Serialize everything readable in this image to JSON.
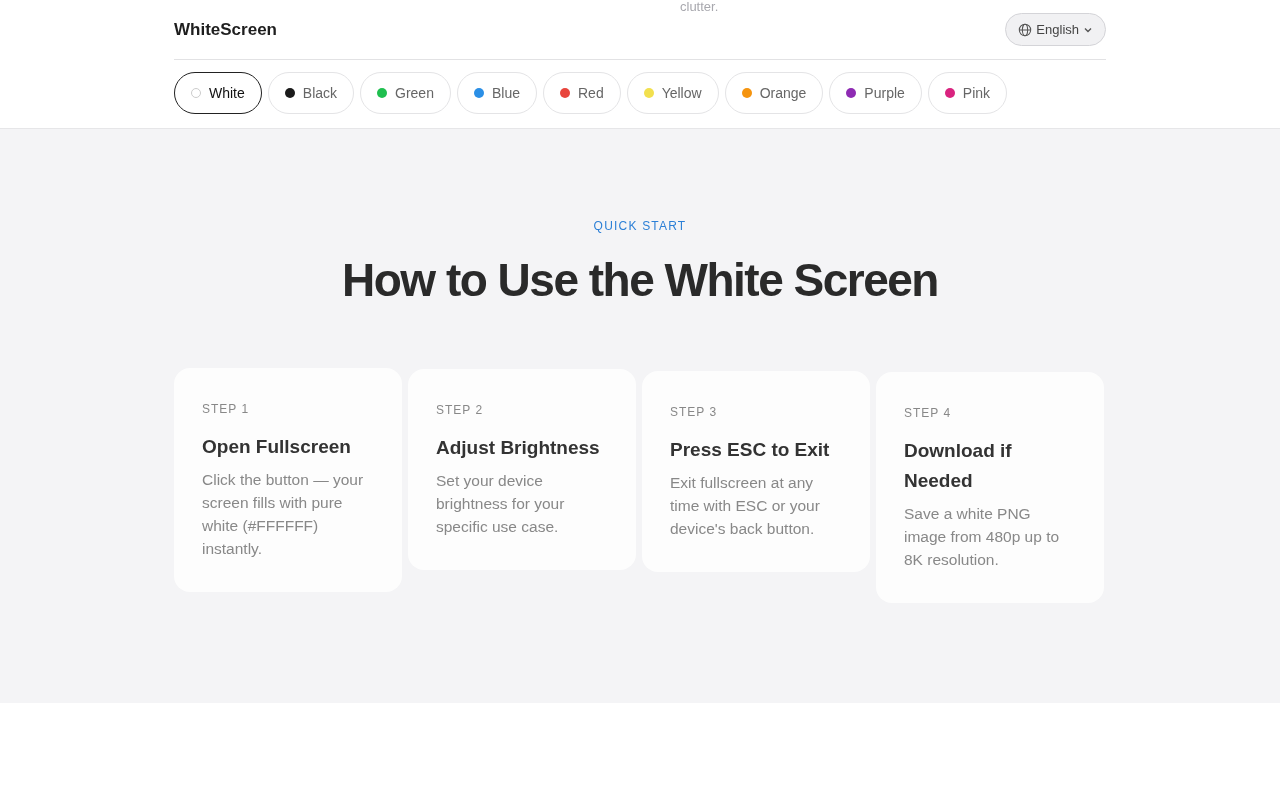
{
  "behind_text": "clutter.",
  "brand": "WhiteScreen",
  "language": {
    "label": "English"
  },
  "colors": [
    {
      "label": "White",
      "color": "#ffffff",
      "selected": true
    },
    {
      "label": "Black",
      "color": "#1a1a1a",
      "selected": false
    },
    {
      "label": "Green",
      "color": "#1fbf4f",
      "selected": false
    },
    {
      "label": "Blue",
      "color": "#2b8fe6",
      "selected": false
    },
    {
      "label": "Red",
      "color": "#e8453c",
      "selected": false
    },
    {
      "label": "Yellow",
      "color": "#f2e04e",
      "selected": false
    },
    {
      "label": "Orange",
      "color": "#f5940f",
      "selected": false
    },
    {
      "label": "Purple",
      "color": "#8e2bb3",
      "selected": false
    },
    {
      "label": "Pink",
      "color": "#d9237f",
      "selected": false
    }
  ],
  "section": {
    "eyebrow": "QUICK START",
    "title": "How to Use the White Screen",
    "steps": [
      {
        "step": "STEP 1",
        "title": "Open Fullscreen",
        "text": "Click the button — your screen fills with pure white (#FFFFFF) instantly."
      },
      {
        "step": "STEP 2",
        "title": "Adjust Brightness",
        "text": "Set your device brightness for your specific use case."
      },
      {
        "step": "STEP 3",
        "title": "Press ESC to Exit",
        "text": "Exit fullscreen at any time with ESC or your device's back button."
      },
      {
        "step": "STEP 4",
        "title": "Download if Needed",
        "text": "Save a white PNG image from 480p up to 8K resolution."
      }
    ]
  }
}
